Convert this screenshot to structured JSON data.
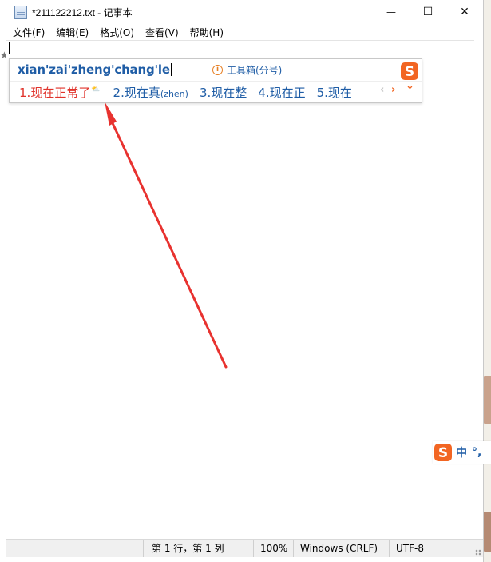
{
  "window": {
    "title": "*211122212.txt - 记事本",
    "controls": {
      "minimize": "—",
      "maximize": "☐",
      "close": "✕"
    }
  },
  "menu": {
    "items": [
      "文件(F)",
      "编辑(E)",
      "格式(O)",
      "查看(V)",
      "帮助(H)"
    ]
  },
  "editor": {
    "content": ""
  },
  "ime": {
    "pinyin": "xian'zai'zheng'chang'le",
    "toolbox_label": "工具箱(分号)",
    "candidates": [
      {
        "index": "1.",
        "text": "现在正常了",
        "hint": "",
        "selected": true
      },
      {
        "index": "2.",
        "text": "现在真",
        "hint": "(zhen)",
        "selected": false
      },
      {
        "index": "3.",
        "text": "现在整",
        "hint": "",
        "selected": false
      },
      {
        "index": "4.",
        "text": "现在正",
        "hint": "",
        "selected": false
      },
      {
        "index": "5.",
        "text": "现在",
        "hint": "",
        "selected": false
      }
    ],
    "nav": {
      "prev": "‹",
      "next": "›",
      "expand": "⌄"
    },
    "colors": {
      "pinyin": "#1f5da6",
      "selected": "#e0332b",
      "logo": "#f26522"
    }
  },
  "ime_status": {
    "mode": "中",
    "punct": "°,"
  },
  "statusbar": {
    "position": "第 1 行，第 1 列",
    "zoom": "100%",
    "line_ending": "Windows (CRLF)",
    "encoding": "UTF-8"
  },
  "annotation": {
    "color": "#e8322f"
  }
}
